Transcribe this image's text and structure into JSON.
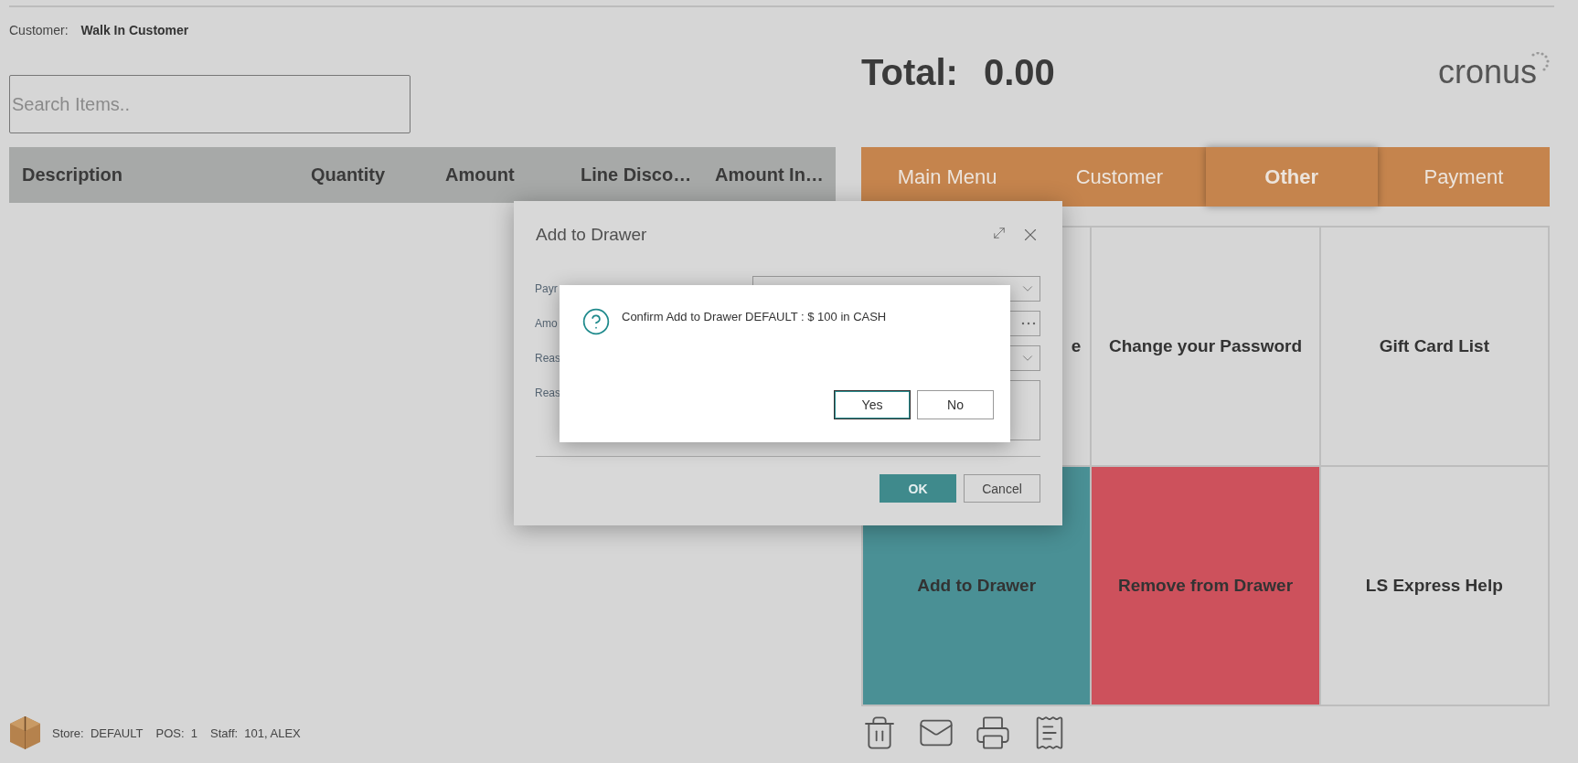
{
  "customer": {
    "label": "Customer:",
    "value": "Walk In Customer"
  },
  "search": {
    "placeholder": "Search Items.."
  },
  "table": {
    "columns": [
      "Description",
      "Quantity",
      "Amount",
      "Line Disco…",
      "Amount In…"
    ]
  },
  "total": {
    "label": "Total:",
    "value": "0.00"
  },
  "logo": {
    "text": "cronus"
  },
  "tabs": [
    {
      "label": "Main Menu",
      "selected": false
    },
    {
      "label": "Customer",
      "selected": false
    },
    {
      "label": "Other",
      "selected": true
    },
    {
      "label": "Payment",
      "selected": false
    }
  ],
  "tiles": [
    {
      "label": "e",
      "color": "#d6d6d6"
    },
    {
      "label": "Change your Password",
      "color": "#d6d6d6"
    },
    {
      "label": "Gift Card List",
      "color": "#d6d6d6"
    },
    {
      "label": "Add to Drawer",
      "color": "#4a9095"
    },
    {
      "label": "Remove from Drawer",
      "color": "#cd515c"
    },
    {
      "label": "LS Express Help",
      "color": "#d6d6d6"
    }
  ],
  "status_bar": {
    "items": [
      {
        "label": "Store:",
        "value": "DEFAULT"
      },
      {
        "label": "POS:",
        "value": "1"
      },
      {
        "label": "Staff:",
        "value": "101, ALEX"
      }
    ]
  },
  "dialog": {
    "title": "Add to Drawer",
    "fields": [
      {
        "label": "Payr",
        "kind": "dropdown"
      },
      {
        "label": "Amo",
        "kind": "lookup"
      },
      {
        "label": "Reas",
        "kind": "dropdown"
      },
      {
        "label": "Reas",
        "kind": "textarea"
      }
    ],
    "buttons": [
      {
        "label": "OK",
        "kind": "primary"
      },
      {
        "label": "Cancel",
        "kind": "secondary"
      }
    ]
  },
  "confirm": {
    "message": "Confirm Add to Drawer DEFAULT : $ 100 in CASH",
    "buttons": [
      {
        "label": "Yes",
        "selected": true
      },
      {
        "label": "No",
        "selected": false
      }
    ]
  }
}
